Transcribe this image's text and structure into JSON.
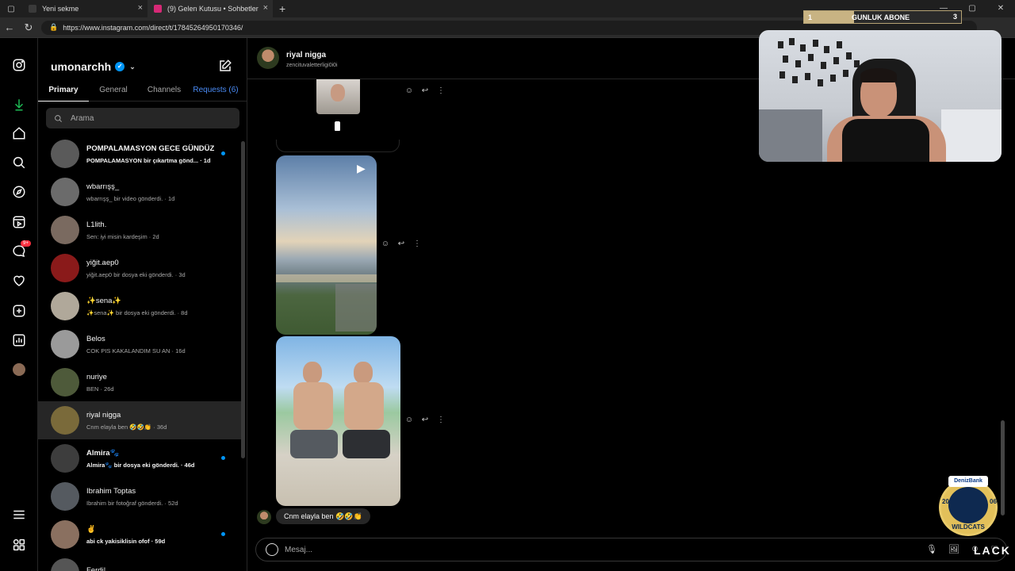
{
  "browser": {
    "tabs": [
      {
        "title": "Yeni sekme",
        "favicon_color": "#3a3a3a"
      },
      {
        "title": "(9) Gelen Kutusu • Sohbetler",
        "favicon_color": "#d62976"
      }
    ],
    "url": "https://www.instagram.com/direct/t/17845264950170346/"
  },
  "inbox": {
    "username": "umonarchh",
    "tabs": {
      "primary": "Primary",
      "general": "General",
      "channels": "Channels",
      "requests": "Requests (6)"
    },
    "search_placeholder": "Arama",
    "conversations": [
      {
        "name": "POMPALAMASYON GECE GÜNDÜZ",
        "preview": "POMPALAMASYON bir çıkartma gönd... · 1d",
        "unread": true,
        "avatar": "#5a5a5a"
      },
      {
        "name": "wbarrışş_",
        "preview": "wbarrışş_ bir video gönderdi. · 1d",
        "unread": false,
        "avatar": "#6b6b6b"
      },
      {
        "name": "L1lith.",
        "preview": "Sen: iyi misin kardeşim · 2d",
        "unread": false,
        "avatar": "#7a6a60"
      },
      {
        "name": "yiğit.aep0",
        "preview": "yiğit.aep0 bir dosya eki gönderdi. · 3d",
        "unread": false,
        "avatar": "#8a1a1a"
      },
      {
        "name": "✨sena✨",
        "preview": "✨sena✨ bir dosya eki gönderdi. · 8d",
        "unread": false,
        "avatar": "#b0a89a"
      },
      {
        "name": "Belos",
        "preview": "COK PIS KAKALANDIM SU AN · 16d",
        "unread": false,
        "avatar": "#9a9a9a"
      },
      {
        "name": "nuriye",
        "preview": "BEN · 26d",
        "unread": false,
        "avatar": "#4e5a3a"
      },
      {
        "name": "riyal nigga",
        "preview": "Cnm elayla ben 🤣🤣👏 · 36d",
        "unread": false,
        "avatar": "#7a6a3a"
      },
      {
        "name": "Almira🐾",
        "preview": "Almira🐾 bir dosya eki gönderdi. · 46d",
        "unread": true,
        "avatar": "#3d3d3d"
      },
      {
        "name": "Ibrahim Toptas",
        "preview": "Ibrahim bir fotoğraf gönderdi. · 52d",
        "unread": false,
        "avatar": "#555a60"
      },
      {
        "name": "✌",
        "preview": "abi ck yakisiklisin ofof · 59d",
        "unread": true,
        "avatar": "#8a7060"
      },
      {
        "name": "Ferdi!",
        "preview": "",
        "unread": false,
        "avatar": "#555555"
      }
    ]
  },
  "chat": {
    "name": "riyal nigga",
    "username": "zencituvaletterligi0i0i",
    "last_message": "Cnm elayla ben 🤣🤣👏",
    "composer_placeholder": "Mesaj...",
    "actions": {
      "react": "☺",
      "reply": "↩",
      "more": "⋮"
    },
    "composer_icons": {
      "mic": "🎙",
      "image": "🖼",
      "sticker": "☺",
      "like": "♡"
    }
  },
  "overlay": {
    "goal_label": "GUNLUK ABONE",
    "goal_min": "1",
    "goal_max": "3",
    "goal_progress": 0.32,
    "badge_brand": "DenizBank",
    "badge_year_left": "20",
    "badge_year_right": "06",
    "badge_name": "WILDCATS",
    "watermark": "LACK"
  }
}
